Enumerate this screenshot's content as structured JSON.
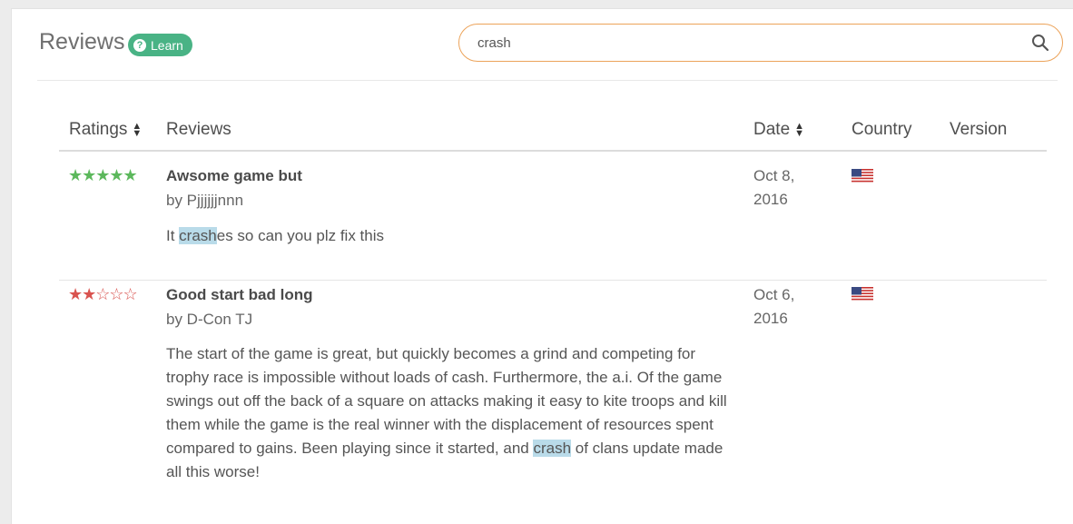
{
  "header": {
    "title": "Reviews",
    "learn_label": "Learn"
  },
  "search": {
    "value": "crash"
  },
  "table": {
    "columns": [
      "Ratings",
      "Reviews",
      "Date",
      "Country",
      "Version"
    ]
  },
  "reviews": [
    {
      "rating": 5,
      "title": "Awsome game but",
      "author": "by Pjjjjjjnnn",
      "body_before": "It ",
      "body_highlight": "crash",
      "body_after": "es so can you plz fix this",
      "date": "Oct 8, 2016",
      "country": "United States flag"
    },
    {
      "rating": 2,
      "title": "Good start bad long",
      "author": "by D-Con TJ",
      "body_before": "The start of the game is great, but quickly becomes a grind and competing for trophy race is impossible without loads of cash. Furthermore, the a.i. Of the game swings out off the back of a square on attacks making it easy to kite troops and kill them while the game is the real winner with the displacement of resources spent compared to gains. Been playing since it started, and ",
      "body_highlight": "crash",
      "body_after": " of clans update made all this worse!",
      "date": "Oct 6, 2016",
      "country": "United States flag"
    }
  ],
  "colors": {
    "accent_green": "#49b385",
    "search_border": "#eca35a",
    "star_green": "#5cb85c",
    "star_red": "#d9534f",
    "highlight": "#b9dbe9"
  }
}
